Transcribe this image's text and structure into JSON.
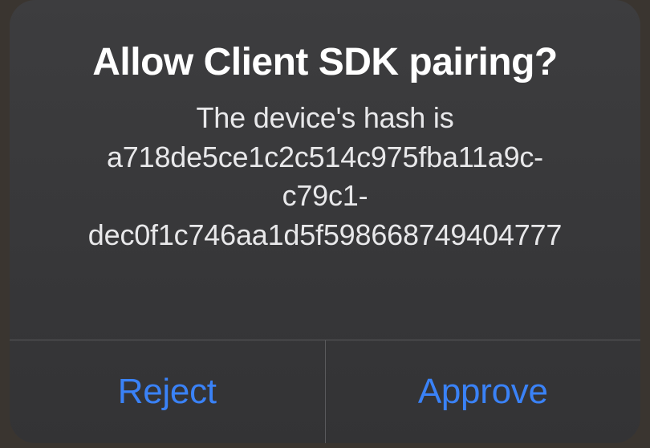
{
  "dialog": {
    "title": "Allow Client SDK pairing?",
    "message_prefix": "The device's hash is",
    "hash_line1": "a718de5ce1c2c514c975fba11a9c-",
    "hash_line2": "c79c1-",
    "hash_line3": "dec0f1c746aa1d5f598668749404777",
    "reject_label": "Reject",
    "approve_label": "Approve"
  },
  "behind": {
    "partial_text": ""
  }
}
